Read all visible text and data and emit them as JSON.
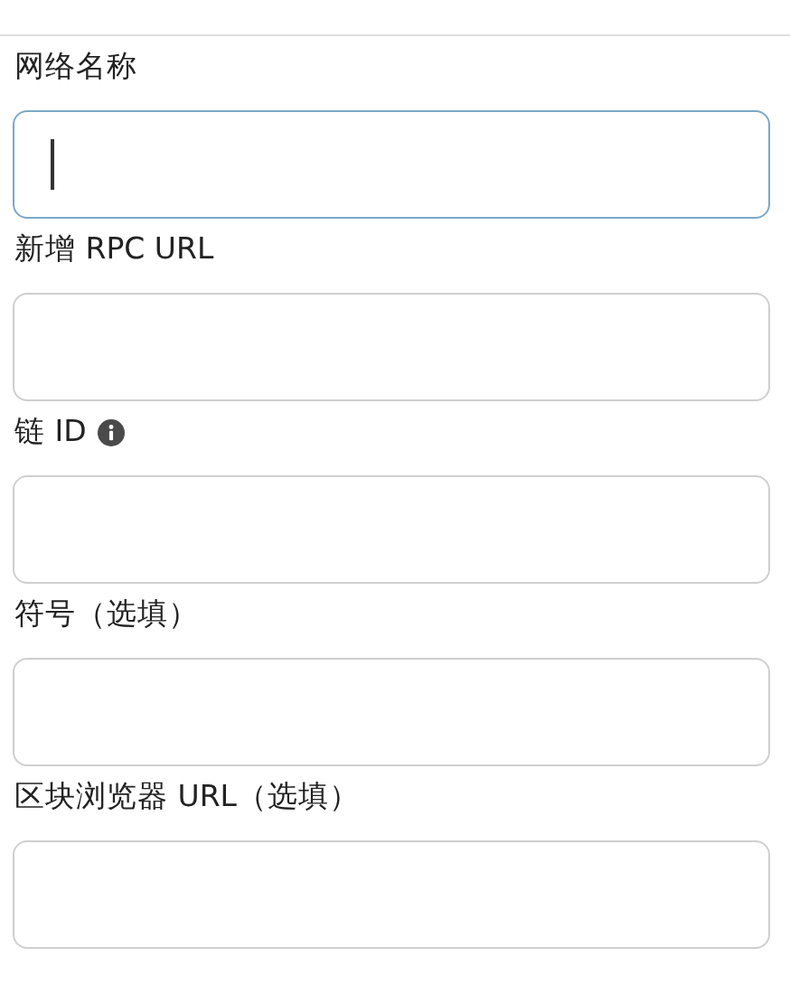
{
  "fields": [
    {
      "label": "网络名称",
      "info": false,
      "focused": true
    },
    {
      "label": "新增 RPC URL",
      "info": false,
      "focused": false
    },
    {
      "label": "链 ID",
      "info": true,
      "focused": false
    },
    {
      "label": "符号（选填）",
      "info": false,
      "focused": false
    },
    {
      "label": "区块浏览器 URL（选填）",
      "info": false,
      "focused": false
    }
  ]
}
